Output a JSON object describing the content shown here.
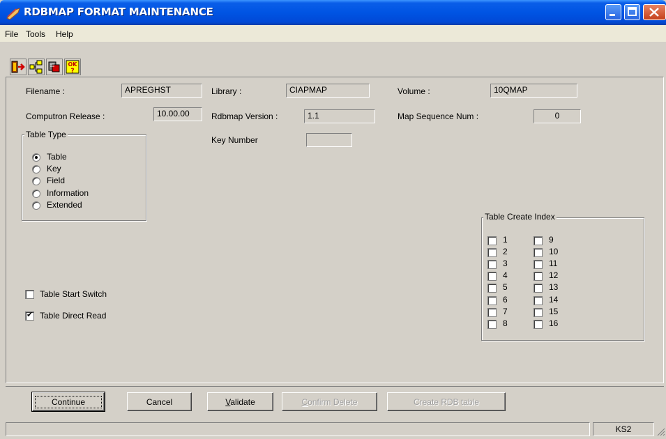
{
  "window": {
    "title": "RDBMAP FORMAT MAINTENANCE",
    "title_bar_color": "#0054e3"
  },
  "menu": {
    "items": [
      {
        "label": "File"
      },
      {
        "label": "Tools"
      },
      {
        "label": "Help"
      }
    ]
  },
  "toolbar": {
    "buttons": [
      {
        "icon": "exit-icon"
      },
      {
        "icon": "tree-icon"
      },
      {
        "icon": "tools-icon"
      },
      {
        "icon": "ok-help-icon",
        "glyph": "OK"
      }
    ]
  },
  "header_fields": {
    "filename": {
      "label": "Filename :",
      "value": "APREGHST"
    },
    "library": {
      "label": "Library :",
      "value": "CIAPMAP"
    },
    "volume": {
      "label": "Volume :",
      "value": "10QMAP"
    },
    "computron_release": {
      "label": "Computron Release :",
      "value": "10.00.00"
    },
    "rdbmap_version": {
      "label": "Rdbmap Version :",
      "value": "1.1"
    },
    "map_sequence_num": {
      "label": "Map Sequence Num :",
      "value": "0"
    },
    "key_number": {
      "label": "Key Number",
      "value": ""
    }
  },
  "table_type": {
    "legend": "Table Type",
    "selected": "Table",
    "options": [
      {
        "label": "Table",
        "checked": true
      },
      {
        "label": "Key",
        "checked": false
      },
      {
        "label": "Field",
        "checked": false
      },
      {
        "label": "Information",
        "checked": false
      },
      {
        "label": "Extended",
        "checked": false
      }
    ]
  },
  "switches": {
    "table_start_switch": {
      "label": "Table Start Switch",
      "checked": false
    },
    "table_direct_read": {
      "label": "Table Direct Read",
      "checked": true
    }
  },
  "table_create_index": {
    "legend": "Table Create Index",
    "column1": [
      "1",
      "2",
      "3",
      "4",
      "5",
      "6",
      "7",
      "8"
    ],
    "column2": [
      "9",
      "10",
      "11",
      "12",
      "13",
      "14",
      "15",
      "16"
    ]
  },
  "buttons": {
    "continue": "Continue",
    "cancel": "Cancel",
    "validate": "Validate",
    "confirm_delete": "Confirm Delete",
    "create_rdb_table": "Create RDB table"
  },
  "status": {
    "pane_text": "KS2"
  }
}
